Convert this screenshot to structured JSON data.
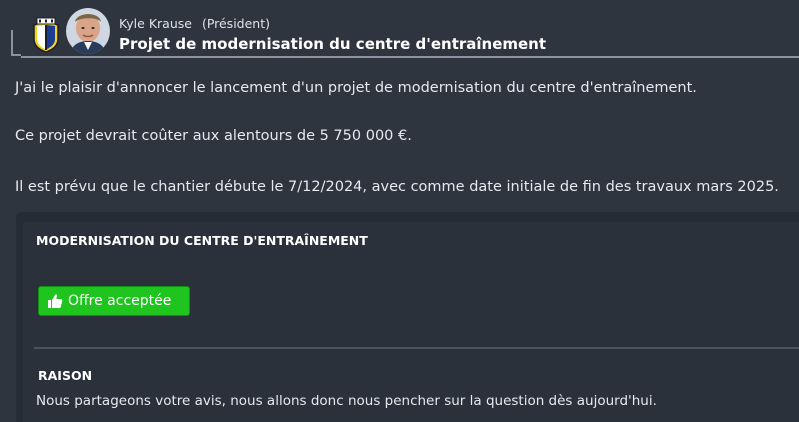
{
  "header": {
    "sender_name": "Kyle Krause",
    "sender_role": "(Président)",
    "subject": "Projet de modernisation du centre d'entraînement",
    "crest_icon": "club-crest-icon",
    "avatar_icon": "avatar-photo-icon"
  },
  "message": {
    "paragraphs": [
      "J'ai le plaisir d'annoncer le lancement d'un projet de modernisation du centre d'entraînement.",
      "Ce projet devrait coûter aux alentours de 5 750 000 €.",
      "Il est prévu que le chantier débute le 7/12/2024, avec comme date initiale de fin des travaux mars 2025."
    ]
  },
  "card": {
    "title": "MODERNISATION DU CENTRE D'ENTRAÎNEMENT",
    "status_button_label": "Offre acceptée",
    "status_icon": "thumbs-up-icon",
    "status_color": "#1fc41f",
    "reason_title": "RAISON",
    "reason_text": "Nous partageons votre avis, nous allons donc nous pencher sur la question dès aujourd'hui."
  }
}
